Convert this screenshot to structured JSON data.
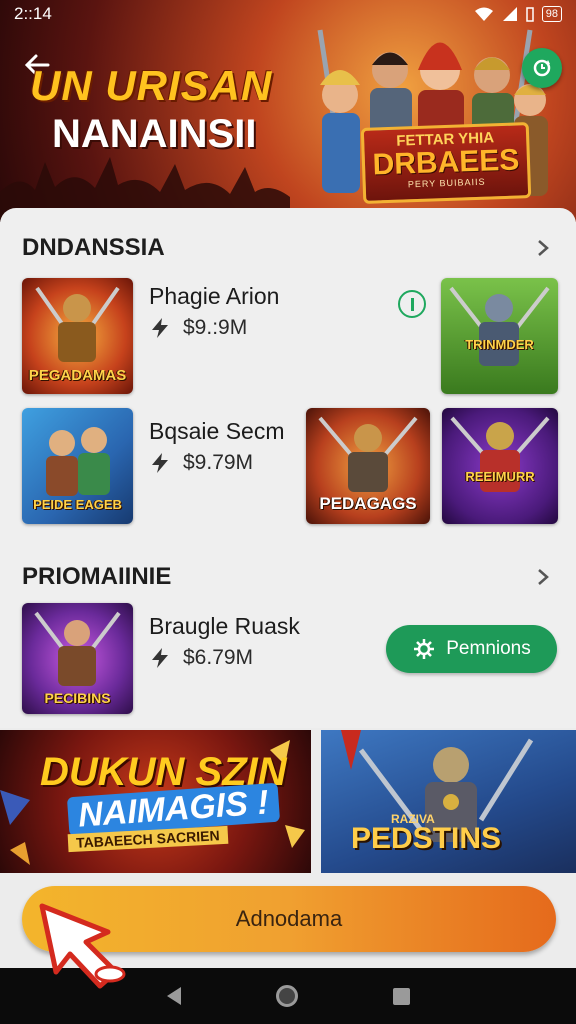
{
  "status": {
    "time": "2::14",
    "battery": "98"
  },
  "hero": {
    "title_line1": "UN URISAN",
    "title_line2": "NANAINSII",
    "logo_line1": "FETTAR YHIA",
    "logo_line2": "DRBAEES",
    "logo_line3": "PERY BUIBAIIS"
  },
  "section1": {
    "title": "DNDANSSIA",
    "apps": [
      {
        "name": "Phagie Arion",
        "stat": "$9.:9M",
        "thumb_label": "PEGADAMAS"
      },
      {
        "name": "Bqsaie Secm",
        "stat": "$9.79M",
        "thumb_label": "PEIDE EAGEB"
      }
    ],
    "side_thumbs": [
      "TRINMDER",
      "PEDAGAGS",
      "REEIMURR"
    ]
  },
  "section2": {
    "title": "PRIOMAIINIE",
    "apps": [
      {
        "name": "Braugle Ruask",
        "stat": "$6.79M",
        "thumb_label": "PECIBINS",
        "action": "Pemnions"
      }
    ]
  },
  "banners": {
    "left_line1": "DUKUN SZIN",
    "left_line2": "NAIMAGIS !",
    "left_line3": "TABAEECH SACRIEN",
    "right_line1": "PEDSTINS",
    "right_line2": "RAZIVA"
  },
  "cta": {
    "label": "Adnodama"
  },
  "colors": {
    "accent_green": "#1e9a58",
    "cta_orange": "#f0a030"
  },
  "icons": [
    "back-arrow-icon",
    "update-icon",
    "chevron-right-icon",
    "bolt-icon",
    "gear-icon",
    "pointer-cursor-icon"
  ]
}
